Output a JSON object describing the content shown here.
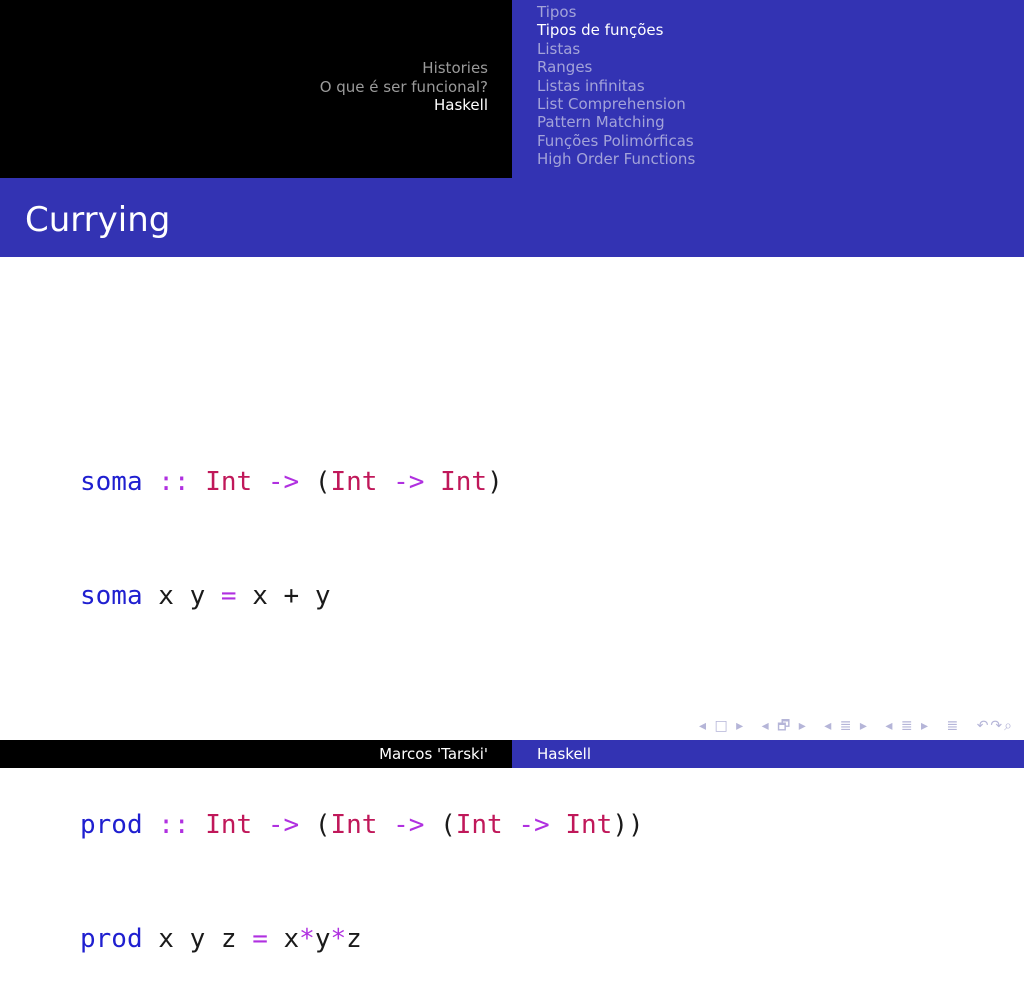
{
  "header": {
    "sections": [
      {
        "label": "Histories",
        "active": false
      },
      {
        "label": "O que é ser funcional?",
        "active": false
      },
      {
        "label": "Haskell",
        "active": true
      }
    ],
    "subsections": [
      {
        "label": "Tipos",
        "active": false
      },
      {
        "label": "Tipos de funções",
        "active": true
      },
      {
        "label": "Listas",
        "active": false
      },
      {
        "label": "Ranges",
        "active": false
      },
      {
        "label": "Listas infinitas",
        "active": false
      },
      {
        "label": "List Comprehension",
        "active": false
      },
      {
        "label": "Pattern Matching",
        "active": false
      },
      {
        "label": "Funções Polimórficas",
        "active": false
      },
      {
        "label": "High Order Functions",
        "active": false
      }
    ]
  },
  "frame": {
    "title": "Currying"
  },
  "code": {
    "line1": {
      "fn": "soma",
      "sep": " :: ",
      "t1": "Int",
      "a1": " -> ",
      "p1": "(",
      "t2": "Int",
      "a2": " -> ",
      "t3": "Int",
      "p2": ")"
    },
    "line2": {
      "fn": "soma",
      "args": " x y ",
      "eq": "=",
      "body1": " x ",
      "op": "+",
      "body2": " y"
    },
    "line3": {
      "fn": "prod",
      "sep": " :: ",
      "t1": "Int",
      "a1": " -> ",
      "p1": "(",
      "t2": "Int",
      "a2": " -> ",
      "p2": "(",
      "t3": "Int",
      "a3": " -> ",
      "t4": "Int",
      "p3": "))"
    },
    "line4": {
      "fn": "prod",
      "args": " x y z ",
      "eq": "=",
      "body1": " x",
      "op1": "*",
      "body2": "y",
      "op2": "*",
      "body3": "z"
    }
  },
  "nav": {
    "frame": "◂ □ ▸",
    "subsection": "◂ 🗗 ▸",
    "section": "◂ ≣ ▸",
    "part": "◂ ≣ ▸",
    "toc": "≣",
    "search": "↶↷⌕"
  },
  "footer": {
    "author": "Marcos 'Tarski'",
    "title": "Haskell"
  }
}
